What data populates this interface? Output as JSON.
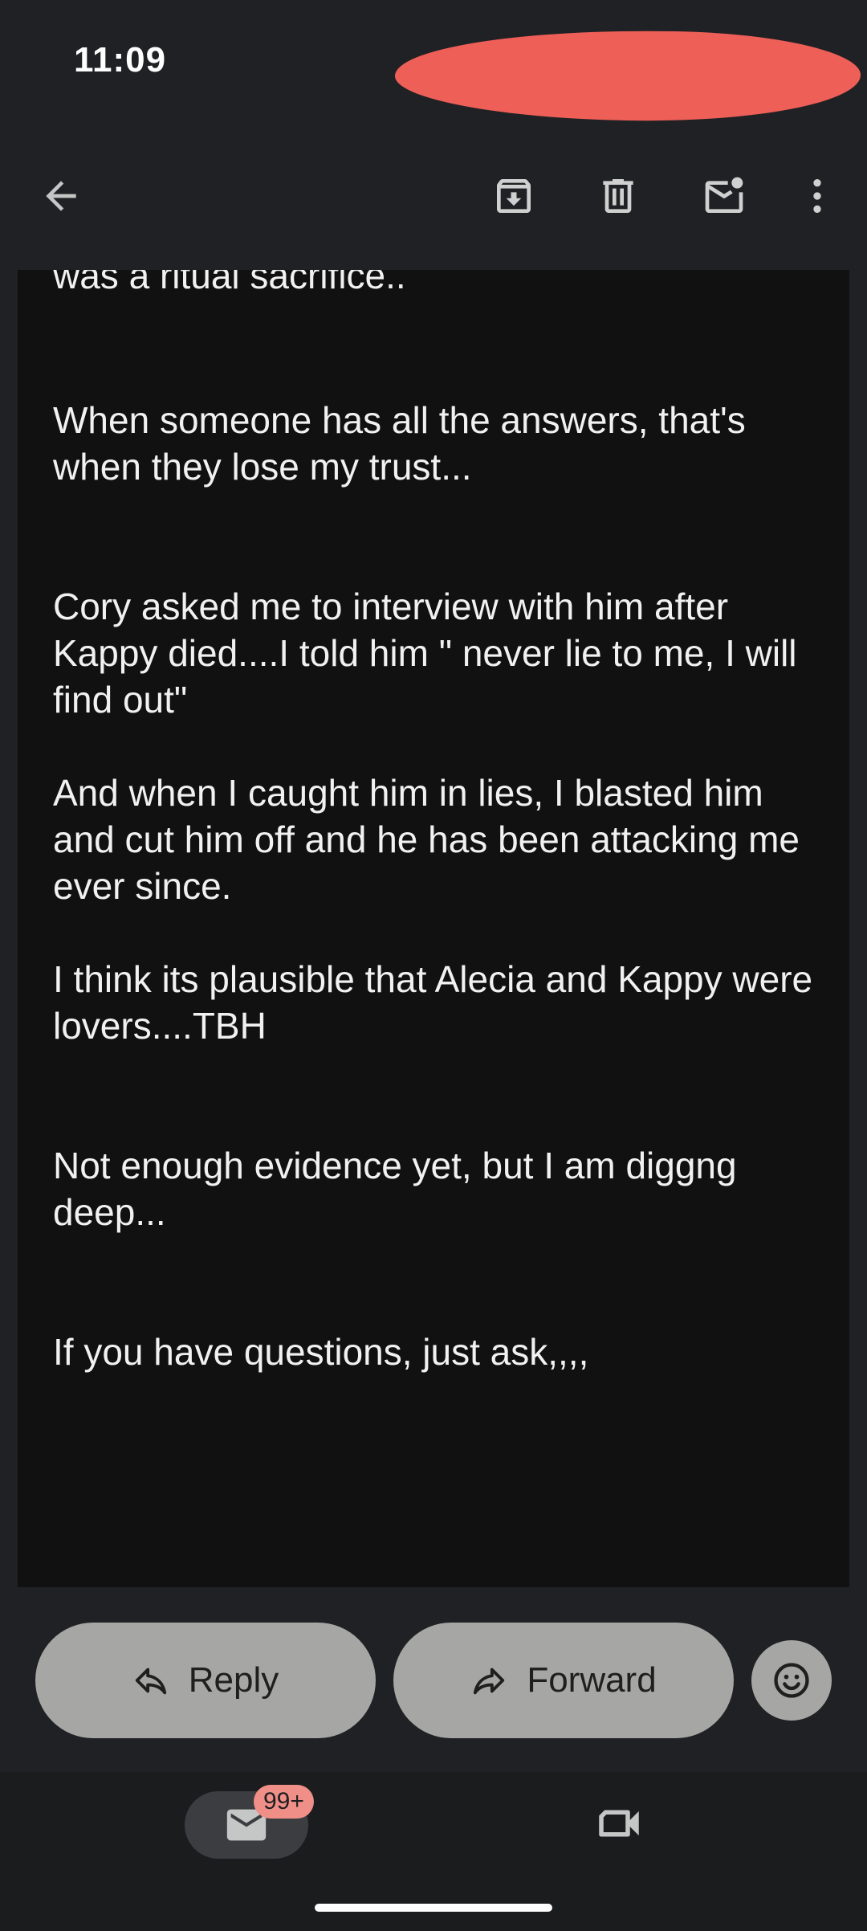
{
  "status_bar": {
    "time": "11:09"
  },
  "toolbar": {
    "icons": [
      "back-arrow-icon",
      "archive-icon",
      "delete-icon",
      "mark-unread-icon",
      "more-vert-icon"
    ]
  },
  "message": {
    "partial_line": "was a ritual sacrifice..",
    "paragraphs": [
      "When someone has all the answers, that's when they lose my trust...",
      "Cory asked me to interview with him after Kappy died....I told him \" never lie to me, I will find out\"",
      "And when I caught him in lies, I blasted him and cut him off and he has been attacking me ever since.",
      "I think its plausible that Alecia and Kappy were lovers....TBH",
      "Not enough evidence yet, but I am diggng deep...",
      "If you have questions, just ask,,,,"
    ]
  },
  "actions": {
    "reply_label": "Reply",
    "forward_label": "Forward"
  },
  "bottom_nav": {
    "mail_badge": "99+"
  },
  "colors": {
    "background": "#202124",
    "message_bg": "#111111",
    "pill": "#a6a6a4",
    "badge": "#f08f88",
    "redaction": "#ee5f58"
  }
}
